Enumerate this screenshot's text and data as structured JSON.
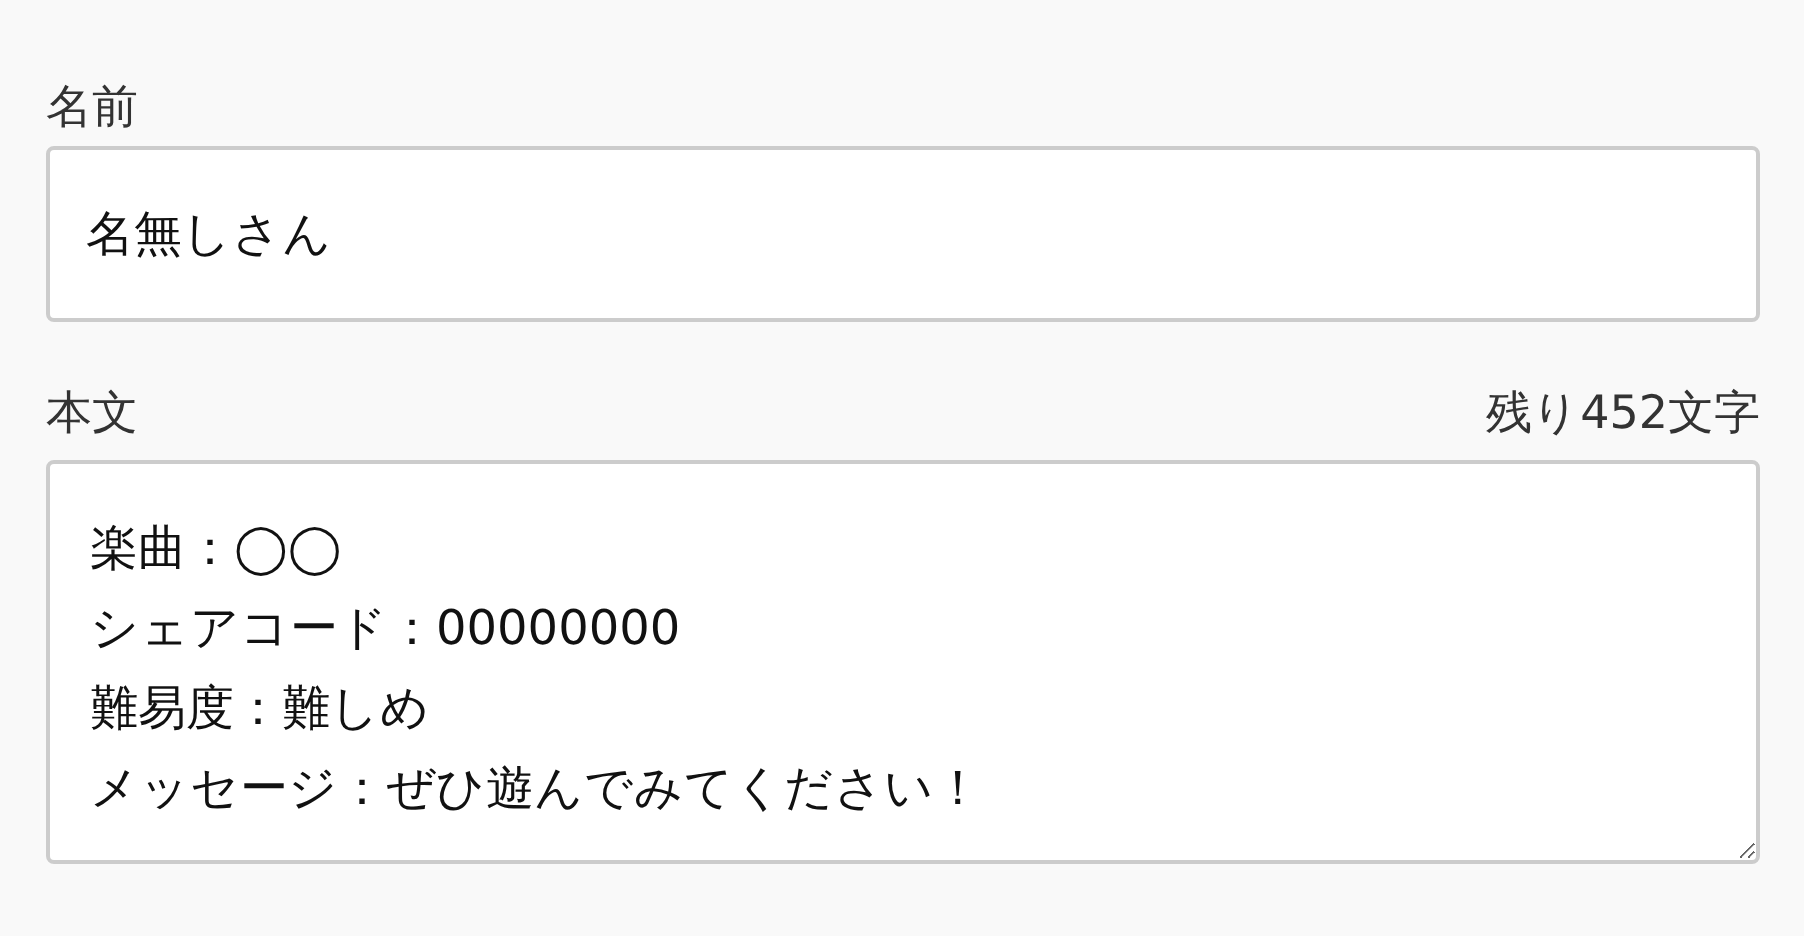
{
  "name_field": {
    "label": "名前",
    "value": "名無しさん"
  },
  "body_field": {
    "label": "本文",
    "counter": "残り452文字",
    "lines": [
      "楽曲：◯◯",
      "シェアコード：00000000",
      "難易度：難しめ",
      "メッセージ：ぜひ遊んでみてください！"
    ]
  }
}
